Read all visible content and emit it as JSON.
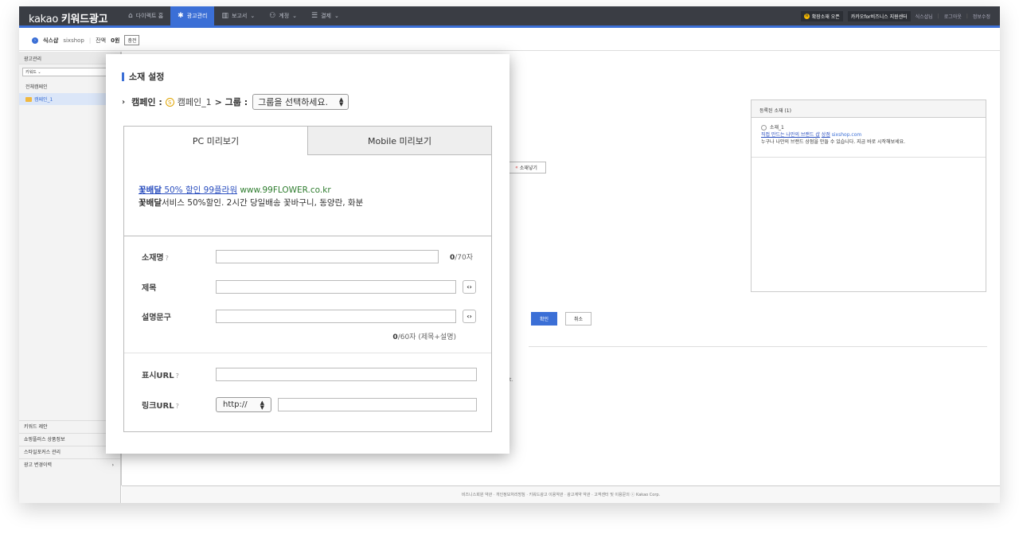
{
  "app": {
    "logo_brand": "kakao",
    "logo_product": "키워드광고"
  },
  "nav": [
    {
      "icon": "home-icon",
      "glyph": "⌂",
      "label": "다이렉트 홈",
      "caret": ""
    },
    {
      "icon": "gear-icon",
      "glyph": "✱",
      "label": "광고관리",
      "caret": ""
    },
    {
      "icon": "chart-icon",
      "glyph": "▥",
      "label": "보고서",
      "caret": "⌄"
    },
    {
      "icon": "user-icon",
      "glyph": "⚇",
      "label": "계정",
      "caret": "⌄"
    },
    {
      "icon": "billing-icon",
      "glyph": "☰",
      "label": "결제",
      "caret": "⌄"
    }
  ],
  "topright": {
    "news_label": "확장소재 오픈",
    "support_label": "카카오for비즈니스 지원센터",
    "user": "식스샵님",
    "logout": "로그아웃",
    "info": "정보수정"
  },
  "account": {
    "name": "식스샵",
    "id": "sixshop",
    "balance_label": "잔액",
    "balance_value": "0원",
    "charge_label": "충전"
  },
  "sidebar": {
    "header": "광고관리",
    "search_placeholder": "키워드 ⌄",
    "all_campaigns": "전체캠페인",
    "campaign": "캠페인_1",
    "links": [
      {
        "label": "키워드 제안",
        "arrow": ""
      },
      {
        "label": "쇼핑플러스 상품정보",
        "arrow": ""
      },
      {
        "label": "스타일포커스 관리",
        "arrow": ""
      },
      {
        "label": "광고 변경이력",
        "arrow": "›"
      }
    ]
  },
  "registered": {
    "header": "등록된 소재 (1)",
    "item_name": "소재_1",
    "item_title": "직접 만드는 나만의 브랜드 샵",
    "item_title_link": "상점",
    "item_url": "sixshop.com",
    "item_desc": "누구나 나만의 브랜드 상점을 만들 수 있습니다. 지금 바로 시작해보세요."
  },
  "insert_button": "소재넣기",
  "insert_arrow": "«",
  "confirm_button": "확인",
  "cancel_button": "취소",
  "bg_fragment": "t.",
  "footer": "비즈니스회원 약관 · 개인정보처리방침 · 키워드광고 이용약관 · 광고계약 약관 · 고객센터 및 이용문의    ⓒ Kakao Corp.",
  "modal": {
    "title": "소재 설정",
    "campaign_label": "캠페인 :",
    "campaign_name": "캠페인_1",
    "group_label": "> 그룹 :",
    "group_select": "그룹을 선택하세요.",
    "tab_pc": "PC 미리보기",
    "tab_mobile": "Mobile 미리보기",
    "preview": {
      "title_bold": "꽃배달",
      "title_rest": " 50% 할인 99플라워",
      "url": " www.99FLOWER.co.kr",
      "desc_bold": "꽃배달",
      "desc_rest": "서비스 50%할인. 2시간 당일배송 꽃바구니, 동양란, 화분"
    },
    "fields": {
      "name_label": "소재명",
      "name_count": "0",
      "name_max": "/70자",
      "title_label": "제목",
      "desc_label": "설명문구",
      "desc_count": "0",
      "desc_max": "/60자 (제목+설명)",
      "display_url_label": "표시URL",
      "link_url_label": "링크URL",
      "protocol": "http://",
      "help_mark": "?"
    }
  }
}
